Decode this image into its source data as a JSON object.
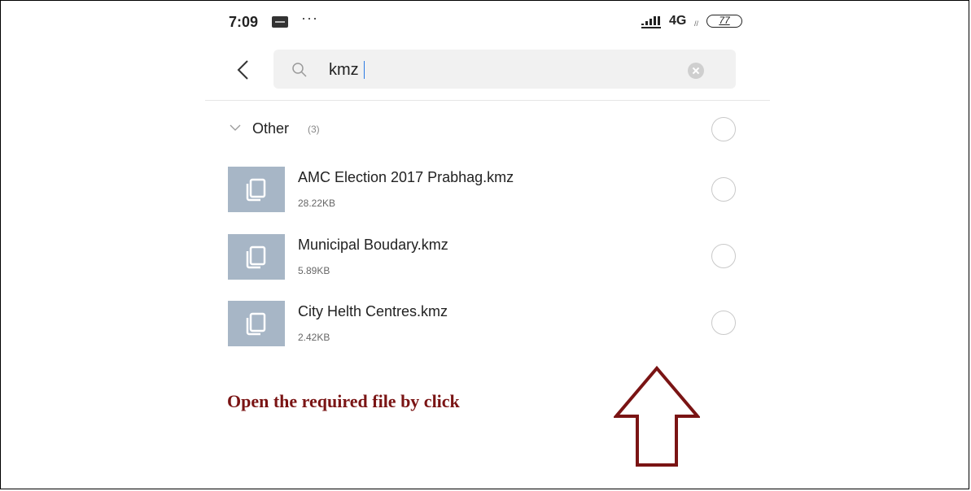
{
  "status_bar": {
    "time": "7:09",
    "more": "···",
    "network": "4G",
    "network_sub": "//",
    "battery": "77"
  },
  "search": {
    "query": "kmz",
    "placeholder": ""
  },
  "section": {
    "title": "Other",
    "count": "(3)"
  },
  "files": [
    {
      "name": "AMC Election 2017 Prabhag.kmz",
      "size": "28.22KB"
    },
    {
      "name": "Municipal Boudary.kmz",
      "size": "5.89KB"
    },
    {
      "name": "City Helth Centres.kmz",
      "size": "2.42KB"
    }
  ],
  "annotation": {
    "text": "Open the required file by click",
    "color": "#7a1414"
  },
  "icons": {
    "back": "chevron-left-icon",
    "search": "search-icon",
    "clear": "clear-icon",
    "file": "document-icon",
    "section": "chevron-down-icon"
  }
}
